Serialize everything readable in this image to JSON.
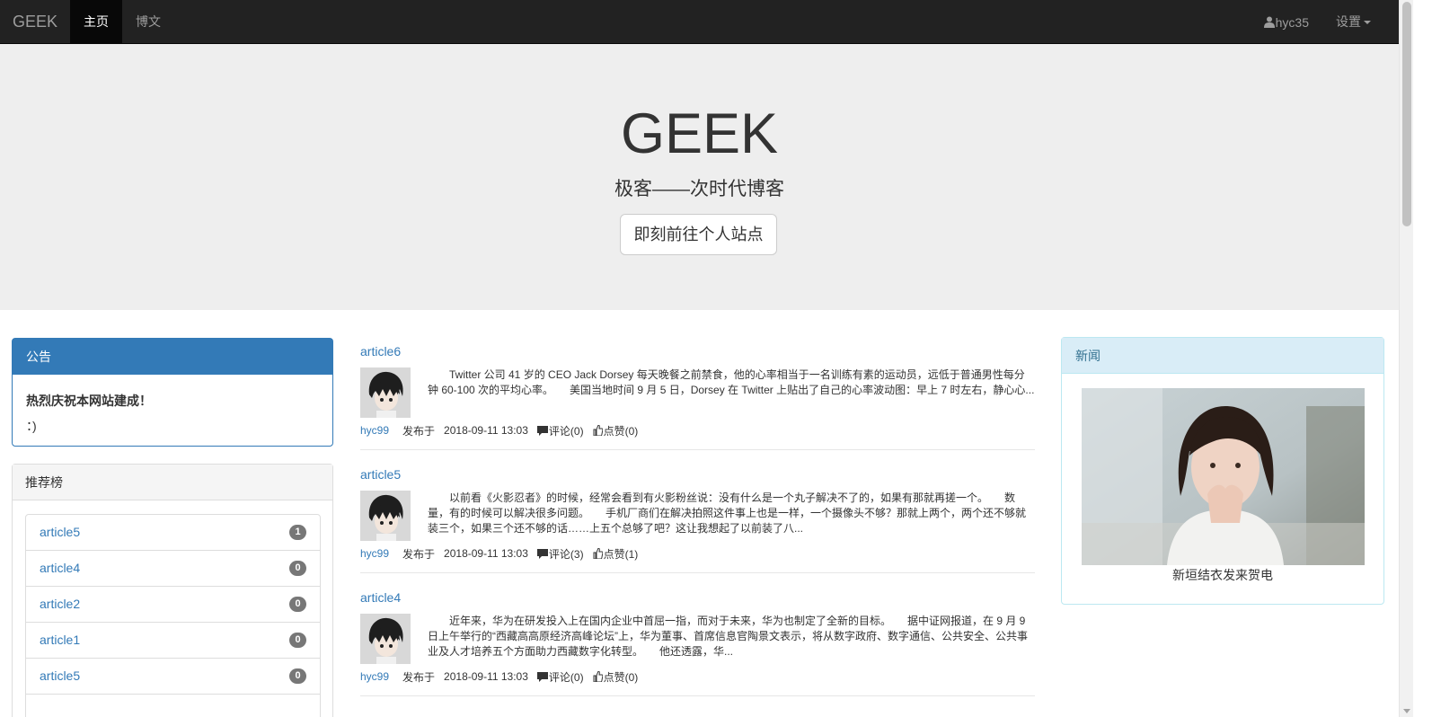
{
  "navbar": {
    "brand": "GEEK",
    "items": [
      {
        "label": "主页",
        "active": true
      },
      {
        "label": "博文",
        "active": false
      }
    ],
    "user": "hyc35",
    "settings": "设置"
  },
  "jumbotron": {
    "title": "GEEK",
    "subtitle": "极客——次时代博客",
    "button": "即刻前往个人站点"
  },
  "notice_panel": {
    "heading": "公告",
    "lines": [
      "热烈庆祝本网站建成！",
      "：)"
    ]
  },
  "ranking_panel": {
    "heading": "推荐榜",
    "items": [
      {
        "label": "article5",
        "count": "1"
      },
      {
        "label": "article4",
        "count": "0"
      },
      {
        "label": "article2",
        "count": "0"
      },
      {
        "label": "article1",
        "count": "0"
      },
      {
        "label": "article5",
        "count": "0"
      }
    ]
  },
  "articles": [
    {
      "title": "article6",
      "summary": "Twitter 公司 41 岁的 CEO Jack Dorsey 每天晚餐之前禁食，他的心率相当于一名训练有素的运动员，远低于普通男性每分钟 60-100 次的平均心率。　　美国当地时间 9 月 5 日，Dorsey 在 Twitter 上贴出了自己的心率波动图：早上 7 时左右，静心心...",
      "author": "hyc99",
      "published_label": "发布于",
      "time": "2018-09-11 13:03",
      "comments": "评论(0)",
      "likes": "点赞(0)"
    },
    {
      "title": "article5",
      "summary": "以前看《火影忍者》的时候，经常会看到有火影粉丝说：没有什么是一个丸子解决不了的，如果有那就再搓一个。　　数量，有的时候可以解决很多问题。　　手机厂商们在解决拍照这件事上也是一样，一个摄像头不够？那就上两个，两个还不够就装三个，如果三个还不够的话……上五个总够了吧？这让我想起了以前装了八...",
      "author": "hyc99",
      "published_label": "发布于",
      "time": "2018-09-11 13:03",
      "comments": "评论(3)",
      "likes": "点赞(1)"
    },
    {
      "title": "article4",
      "summary": "近年来，华为在研发投入上在国内企业中首屈一指，而对于未来，华为也制定了全新的目标。　　据中证网报道，在 9 月 9 日上午举行的“西藏高高原经济高峰论坛”上，华为董事、首席信息官陶景文表示，将从数字政府、数字通信、公共安全、公共事业及人才培养五个方面助力西藏数字化转型。　　他还透露，华...",
      "author": "hyc99",
      "published_label": "发布于",
      "time": "2018-09-11 13:03",
      "comments": "评论(0)",
      "likes": "点赞(0)"
    }
  ],
  "news_panel": {
    "heading": "新闻",
    "caption": "新垣结衣发来贺电"
  }
}
